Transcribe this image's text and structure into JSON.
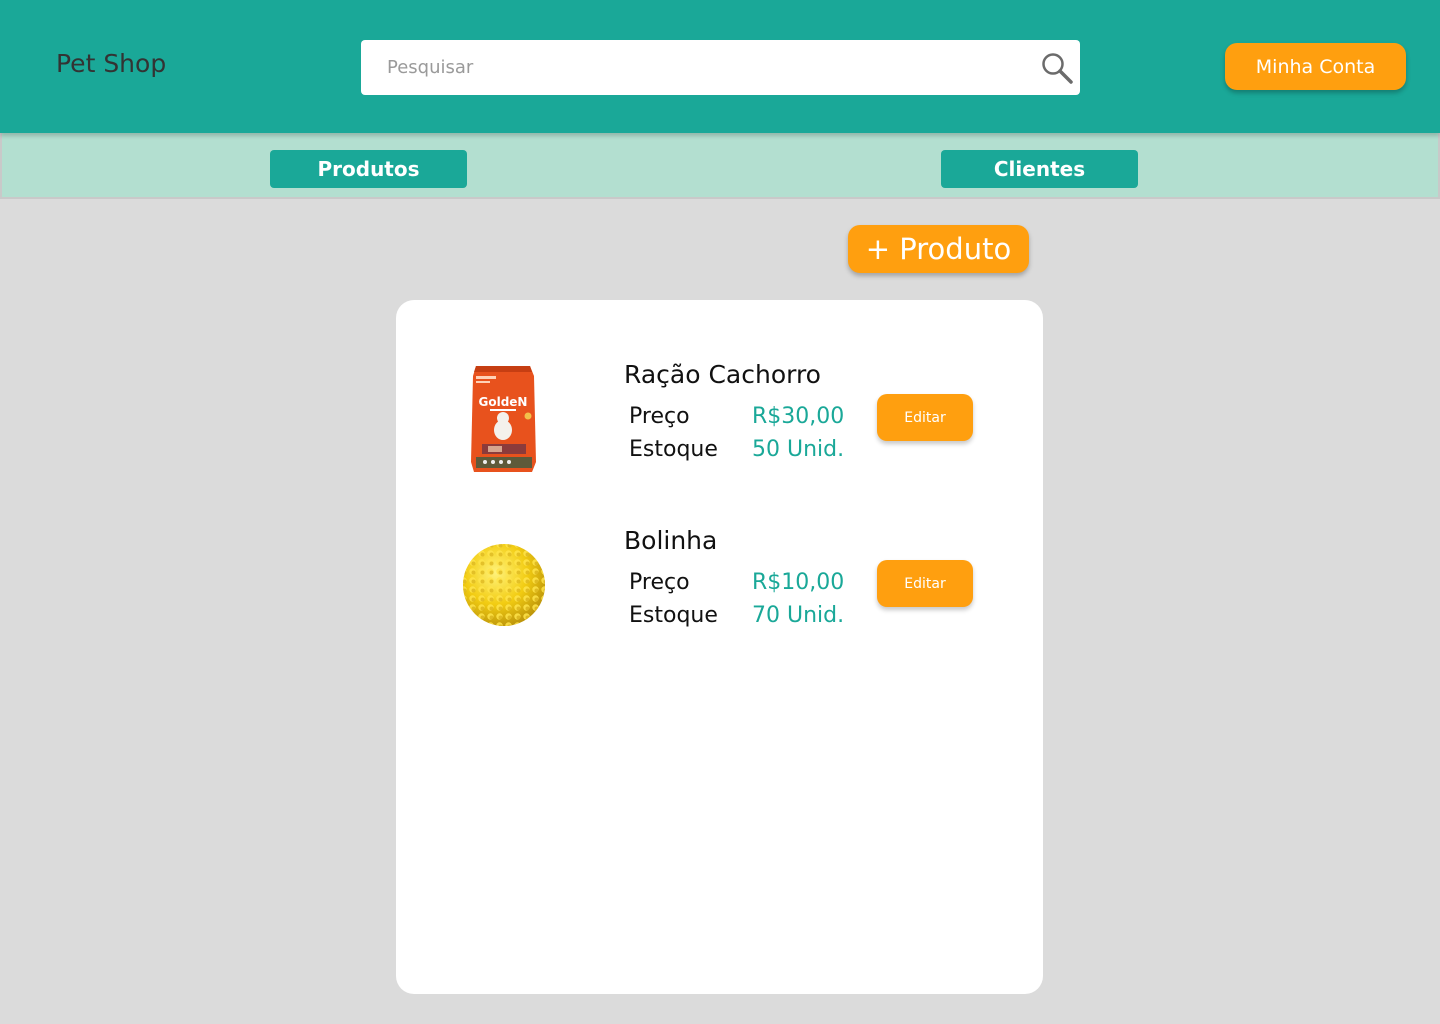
{
  "header": {
    "brand": "Pet Shop",
    "search": {
      "placeholder": "Pesquisar",
      "value": "",
      "icon": "search-icon"
    },
    "account_label": "Minha Conta"
  },
  "nav": {
    "tabs": [
      {
        "label": "Produtos"
      },
      {
        "label": "Clientes"
      }
    ]
  },
  "actions": {
    "add_product_label": "+ Produto"
  },
  "products": [
    {
      "name": "Ração Cachorro",
      "price_label": "Preço",
      "price": "R$30,00",
      "stock_label": "Estoque",
      "stock": "50 Unid.",
      "edit_label": "Editar",
      "image": "dog-food-bag-image",
      "image_text": "GoldeN"
    },
    {
      "name": "Bolinha",
      "price_label": "Preço",
      "price": "R$10,00",
      "stock_label": "Estoque",
      "stock": "70 Unid.",
      "edit_label": "Editar",
      "image": "yellow-ball-image"
    }
  ],
  "colors": {
    "primary": "#1aa898",
    "nav_background": "#b3dfd0",
    "accent": "#ff9f0f",
    "page_background": "#dbdbdb"
  }
}
